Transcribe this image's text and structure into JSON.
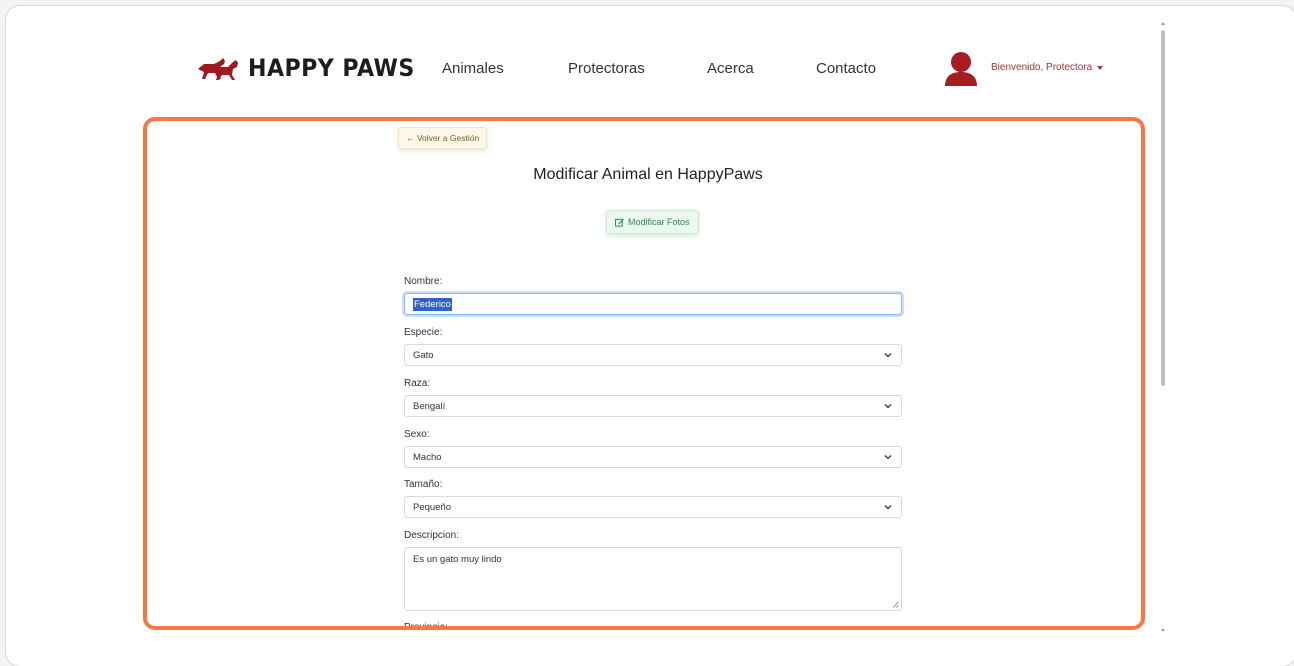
{
  "brand": {
    "name": "HAPPY PAWS",
    "logo_icon": "dogs-logo-icon",
    "color": "#9b1b1f"
  },
  "nav": {
    "links": [
      "Animales",
      "Protectoras",
      "Acerca",
      "Contacto"
    ],
    "user_menu": "Bienvenido, Protectora",
    "avatar_icon": "user-avatar-icon"
  },
  "form": {
    "back_label": "← Volver a Gestión",
    "title": "Modificar Animal en HappyPaws",
    "photos_label": "Modificar Fotos",
    "fields": {
      "nombre": {
        "label": "Nombre:",
        "value": "Federico"
      },
      "especie": {
        "label": "Especie:",
        "value": "Gato"
      },
      "raza": {
        "label": "Raza:",
        "value": "Bengalí"
      },
      "sexo": {
        "label": "Sexo:",
        "value": "Macho"
      },
      "tamano": {
        "label": "Tamaño:",
        "value": "Pequeño"
      },
      "descripcion": {
        "label": "Descripcion:",
        "value": "Es un gato muy lindo"
      },
      "provincia": {
        "label": "Provincia:"
      }
    }
  },
  "colors": {
    "highlight": "#f47942",
    "accent_red": "#a3343a",
    "focus": "#86b7fe"
  }
}
